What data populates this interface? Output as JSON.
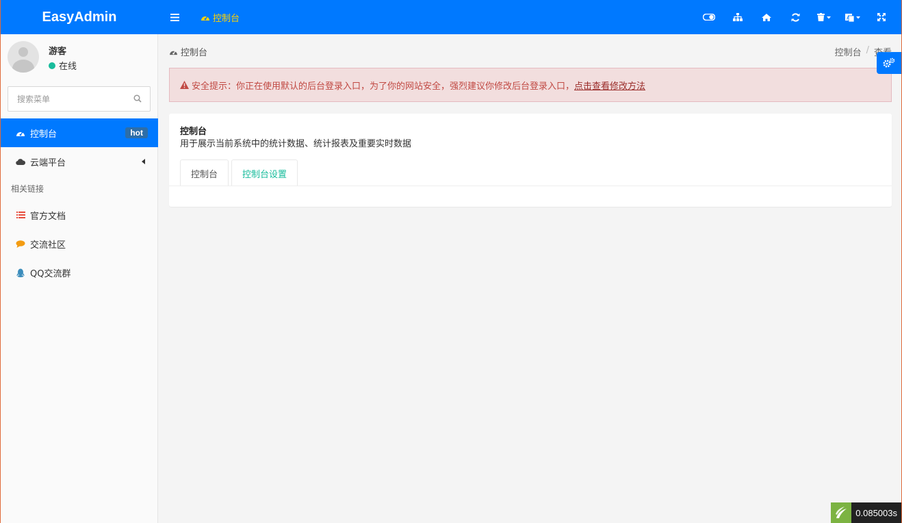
{
  "app": {
    "logo": "EasyAdmin"
  },
  "header": {
    "active_tab": "控制台",
    "toolbar": [
      "theme-toggle",
      "sitemap",
      "home",
      "refresh",
      "clear-cache",
      "language",
      "fullscreen"
    ]
  },
  "user": {
    "name": "游客",
    "status": "在线"
  },
  "search": {
    "placeholder": "搜索菜单"
  },
  "sidebar": {
    "items": [
      {
        "label": "控制台",
        "icon": "dashboard-icon",
        "badge": "hot",
        "active": true
      },
      {
        "label": "云端平台",
        "icon": "cloud-icon"
      }
    ],
    "section_header": "相关链接",
    "links": [
      {
        "label": "官方文档",
        "icon": "list-icon",
        "color": "#e74c3c"
      },
      {
        "label": "交流社区",
        "icon": "comment-icon",
        "color": "#f39c12"
      },
      {
        "label": "QQ交流群",
        "icon": "qq-icon",
        "color": "#3c8dbc"
      }
    ]
  },
  "content": {
    "page_title": "控制台",
    "breadcrumb": [
      "控制台",
      "查看"
    ],
    "alert": {
      "text": "安全提示：你正在使用默认的后台登录入口，为了你的网站安全，强烈建议你修改后台登录入口，",
      "link": "点击查看修改方法"
    },
    "panel": {
      "title": "控制台",
      "description": "用于展示当前系统中的统计数据、统计报表及重要实时数据",
      "tabs": [
        "控制台",
        "控制台设置"
      ]
    }
  },
  "debug": {
    "time": "0.085003s"
  },
  "colors": {
    "primary": "#0079ff",
    "accent": "#ffd200",
    "success": "#18bc9c",
    "danger": "#c14943"
  }
}
